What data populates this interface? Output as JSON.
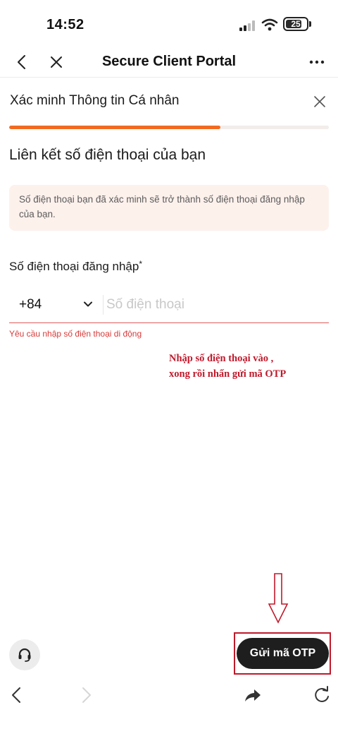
{
  "status_bar": {
    "time": "14:52",
    "battery": "25",
    "icons": [
      "signal-icon",
      "wifi-icon",
      "battery-icon"
    ]
  },
  "browser": {
    "title": "Secure Client Portal",
    "icons": [
      "back-icon",
      "close-icon",
      "more-icon"
    ]
  },
  "modal": {
    "title": "Xác minh Thông tin Cá nhân",
    "progress": 0.66
  },
  "content": {
    "heading": "Liên kết số điện thoại của bạn",
    "info": "Số điện thoại bạn đã xác minh sẽ trở thành số điện thoại đăng nhập của bạn.",
    "field_label": "Số điện thoại đăng nhập",
    "required_mark": "*",
    "country_code": "+84",
    "phone_value": "",
    "phone_placeholder": "Số điện thoại",
    "error": "Yêu cầu nhập số điện thoại di động"
  },
  "annotation": {
    "line1": "Nhập số điện thoại vào ,",
    "line2": "xong rồi nhấn gửi mã OTP"
  },
  "actions": {
    "otp_button": "Gửi mã OTP",
    "support_icon": "headset-icon"
  },
  "bottom_toolbar": {
    "icons": [
      "back-arrow-icon",
      "forward-arrow-icon",
      "share-icon",
      "reload-icon"
    ]
  },
  "colors": {
    "accent": "#f26a1f",
    "error": "#d93a3a",
    "info_bg": "#fdf1ec",
    "annotation": "#c0192b",
    "button_dark": "#1e1e1e"
  }
}
